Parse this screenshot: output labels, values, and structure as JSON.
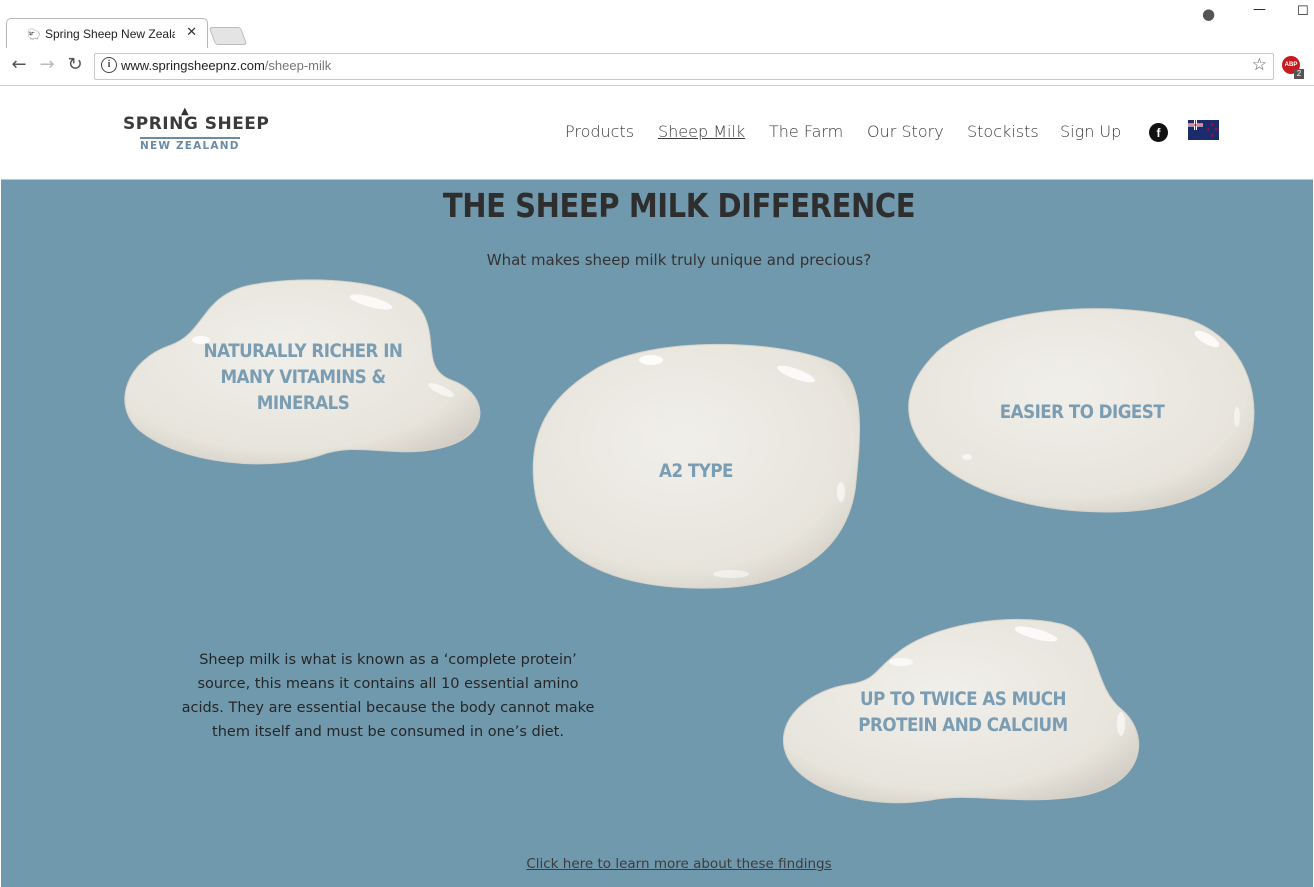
{
  "browser": {
    "tab_title": "Spring Sheep New Zeala",
    "tab_close": "✕",
    "url_host": "www.springsheepnz.com",
    "url_path": "/sheep-milk",
    "abp_label": "ABP",
    "abp_count": "2"
  },
  "header": {
    "logo_brand": "SPRING SHEEP",
    "logo_sub": "NEW ZEALAND",
    "nav": [
      {
        "label": "Products"
      },
      {
        "label": "Sheep Milk"
      },
      {
        "label": "The Farm"
      },
      {
        "label": "Our Story"
      },
      {
        "label": "Stockists"
      },
      {
        "label": "Sign Up"
      }
    ],
    "facebook_label": "f",
    "flag": "new-zealand-flag"
  },
  "main": {
    "title": "THE SHEEP MILK DIFFERENCE",
    "subtitle": "What makes sheep milk truly unique and precious?",
    "blobs": [
      {
        "lines": [
          "NATURALLY RICHER IN",
          "MANY VITAMINS &",
          "MINERALS"
        ]
      },
      {
        "lines": [
          "A2 TYPE"
        ]
      },
      {
        "lines": [
          "EASIER TO DIGEST"
        ]
      },
      {
        "lines": [
          "UP TO TWICE AS MUCH",
          "PROTEIN AND CALCIUM"
        ]
      }
    ],
    "body_text": "Sheep milk is what is known as a ‘complete protein’ source, this means it contains all 10 essential amino acids. They are essential because the body cannot make them itself and must be consumed in one’s diet.",
    "findings_link": "Click here to learn more about these findings"
  },
  "colors": {
    "background": "#7199ae",
    "milk": "#ebe8e1",
    "blob_text": "#7a9db3",
    "title_text": "#2e2e2e"
  }
}
